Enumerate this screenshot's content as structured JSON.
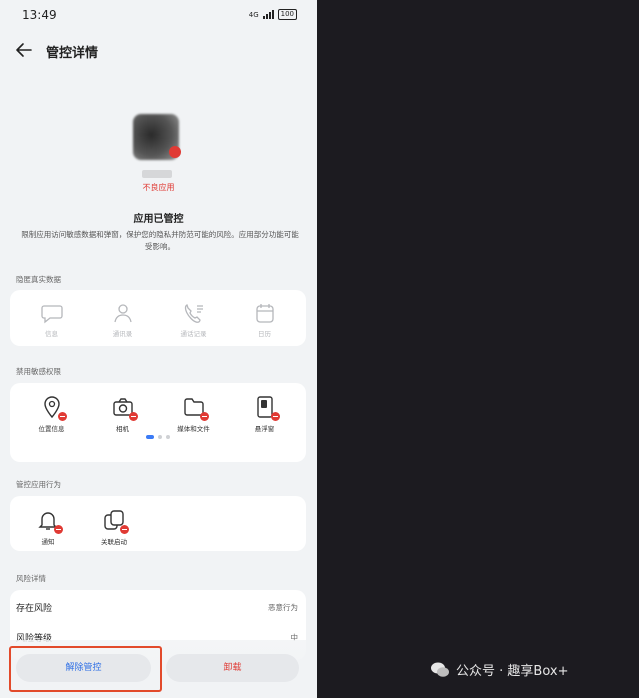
{
  "status": {
    "time": "13:49",
    "network": "4G",
    "battery": "100"
  },
  "header": {
    "title": "管控详情"
  },
  "app": {
    "bad_label": "不良应用",
    "status_title": "应用已管控",
    "description": "限制应用访问敏感数据和弹窗，保护您的隐私并防范可能的风险。应用部分功能可能受影响。"
  },
  "hidden_data": {
    "label": "隐匿真实数据",
    "items": [
      {
        "label": "信息",
        "icon": "message-icon"
      },
      {
        "label": "通讯录",
        "icon": "contacts-icon"
      },
      {
        "label": "通话记录",
        "icon": "call-log-icon"
      },
      {
        "label": "日历",
        "icon": "calendar-icon"
      }
    ]
  },
  "disabled_perms": {
    "label": "禁用敏感权限",
    "items": [
      {
        "label": "位置信息",
        "icon": "location-icon"
      },
      {
        "label": "相机",
        "icon": "camera-icon"
      },
      {
        "label": "媒体和文件",
        "icon": "folder-icon"
      },
      {
        "label": "悬浮窗",
        "icon": "floating-window-icon"
      }
    ]
  },
  "behavior": {
    "label": "管控应用行为",
    "items": [
      {
        "label": "通知",
        "icon": "bell-icon"
      },
      {
        "label": "关联启动",
        "icon": "linked-launch-icon"
      }
    ]
  },
  "risk": {
    "label": "风险详情",
    "rows": [
      {
        "name": "存在风险",
        "value": "恶意行为"
      },
      {
        "name": "风险等级",
        "value": "中"
      }
    ]
  },
  "buttons": {
    "release": "解除管控",
    "uninstall": "卸载"
  },
  "watermark": {
    "text": "公众号 · 趣享Box+"
  },
  "colors": {
    "accent": "#2f6fe5",
    "danger": "#e03a34",
    "highlight": "#e24a2b"
  }
}
